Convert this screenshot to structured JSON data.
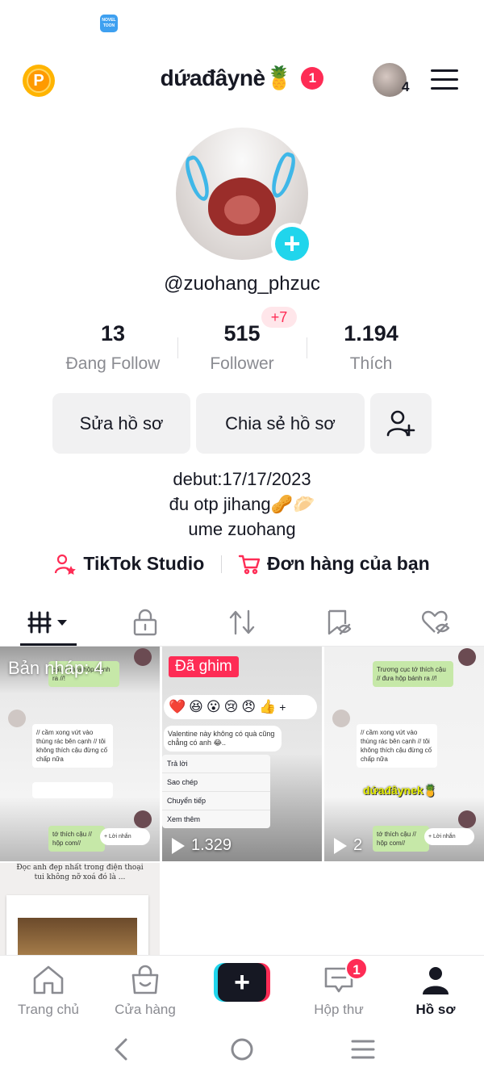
{
  "status_bar": {
    "app_icon_text": "NOVEL TOON"
  },
  "header": {
    "points_label": "P",
    "username": "dứađâynè🍍",
    "notification_count": "1",
    "account_count": "4"
  },
  "profile": {
    "handle": "@zuohang_phzuc",
    "stats": [
      {
        "value": "13",
        "label": "Đang Follow"
      },
      {
        "value": "515",
        "label": "Follower",
        "badge": "+7"
      },
      {
        "value": "1.194",
        "label": "Thích"
      }
    ],
    "buttons": {
      "edit": "Sửa hồ sơ",
      "share": "Chia sẻ hồ sơ"
    },
    "bio": [
      "debut:17/17/2023",
      "đu otp jihang🥜🥟",
      "ume zuohang"
    ],
    "links": {
      "studio": "TikTok Studio",
      "orders": "Đơn hàng của bạn"
    }
  },
  "tabs": [
    "videos-grid",
    "private",
    "reposts",
    "favorites",
    "liked"
  ],
  "grid": {
    "drafts_label": "Bản nháp: 4",
    "pinned_label": "Đã ghim",
    "views_2": "1.329",
    "views_3": "2",
    "tile1_chats": [
      "cậu // đưa hộp bánh ra //!",
      "// cầm xong vứt vào thùng rác bên cạnh // tôi không thích cậu đừng cố chấp nữa",
      "tớ thích cậu // hộp com//",
      "+ Lời nhắn"
    ],
    "tile2": {
      "emojis": [
        "❤️",
        "😆",
        "😮",
        "😢",
        "😠",
        "👍"
      ],
      "message": "Valentine này không có quà cũng chẳng có anh 😂..",
      "menu": [
        "Trả lời",
        "Sao chép",
        "Chuyển tiếp",
        "Xem thêm"
      ]
    },
    "tile3_chats": [
      "Trương cục tớ thích cậu // đưa hộp bánh ra //!",
      "// cầm xong vứt vào thùng rác bên cạnh // tôi không thích cậu đừng cố chấp nữa",
      "tớ thích cậu // hộp com//",
      "+ Lời nhắn"
    ],
    "tile3_sticker": "dứađâynek🍍",
    "tile4_text": [
      "Đọc anh đẹp nhất trong điện thoại",
      "tui không nỡ xoá đó là ..."
    ]
  },
  "bottom_nav": {
    "home": "Trang chủ",
    "shop": "Cửa hàng",
    "inbox": "Hộp thư",
    "inbox_badge": "1",
    "profile": "Hồ sơ"
  },
  "colors": {
    "accent_red": "#fe2c55",
    "accent_cyan": "#20d5ec",
    "text_primary": "#161823",
    "text_secondary": "#8a8b91"
  }
}
